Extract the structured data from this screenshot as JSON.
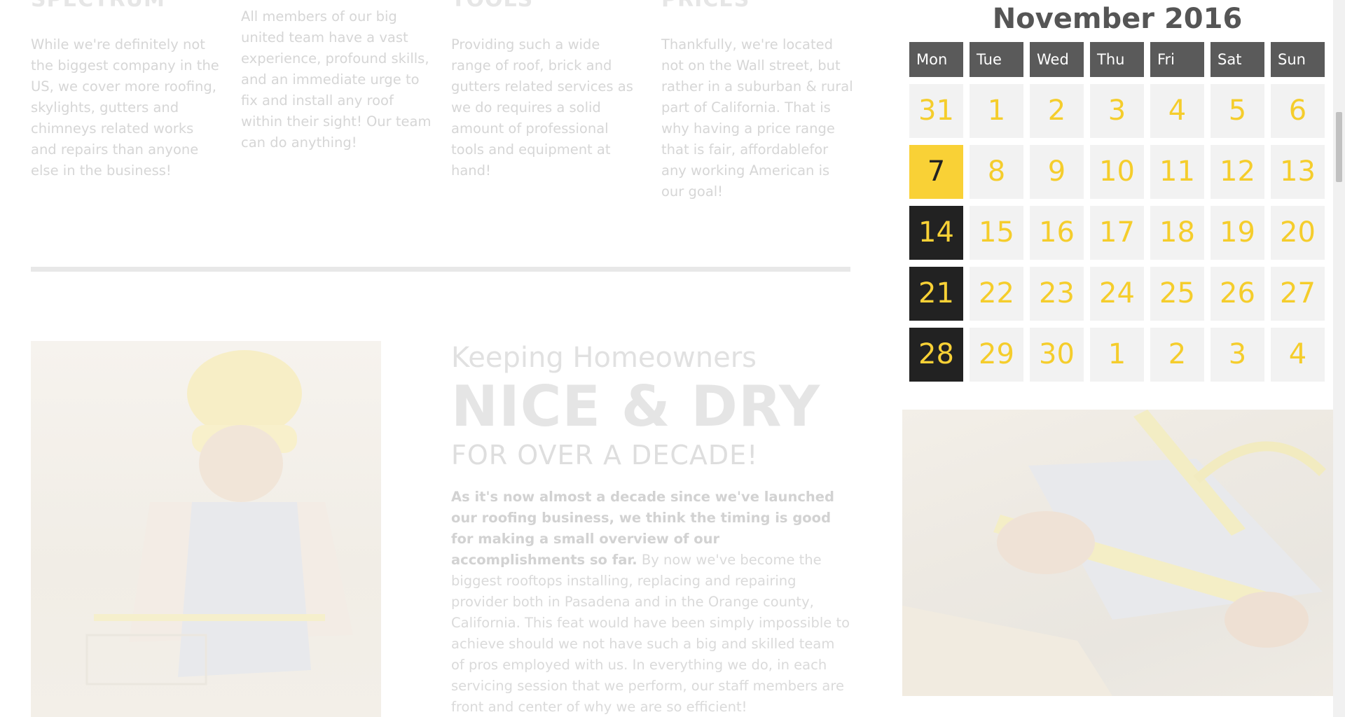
{
  "features": [
    {
      "heading": "SPECTRUM",
      "text": "While we're definitely not the biggest company in the US, we cover more roofing, skylights, gutters and chimneys related works and repairs than anyone else in the business!"
    },
    {
      "heading": "",
      "text": "All members of our big united team have a vast experience, profound skills, and an immediate urge to fix and install any roof within their sight! Our team can do anything!"
    },
    {
      "heading": "TOOLS",
      "text": "Providing such a wide range of roof, brick and gutters related services as we do requires a solid amount of professional tools and equipment at hand!"
    },
    {
      "heading": "PRICES",
      "text": "Thankfully, we're located not on the Wall street, but rather in a suburban & rural part of California. That is why having a price range that is fair, affordablefor any working American is our goal!"
    }
  ],
  "intro": {
    "small_heading": "Keeping Homeowners",
    "big_heading": "NICE & DRY",
    "sub_heading": "FOR OVER A DECADE!",
    "lead_text": "As it's now almost a decade since we've launched our roofing business, we think the timing is good for making a small overview of our accomplishments so far.",
    "body_text": " By now we've become the biggest rooftops installing, replacing and repairing provider both in Pasadena and in the Orange county, California. This feat would have been simply impossible to achieve should we not have such a big and skilled team of pros employed with us. In everything we do, in each servicing session that we perform, our staff members are front and center of why we are so efficient!"
  },
  "calendar": {
    "title": "November 2016",
    "weekdays": [
      "Mon",
      "Tue",
      "Wed",
      "Thu",
      "Fri",
      "Sat",
      "Sun"
    ],
    "weeks": [
      [
        "31",
        "1",
        "2",
        "3",
        "4",
        "5",
        "6"
      ],
      [
        "7",
        "8",
        "9",
        "10",
        "11",
        "12",
        "13"
      ],
      [
        "14",
        "15",
        "16",
        "17",
        "18",
        "19",
        "20"
      ],
      [
        "21",
        "22",
        "23",
        "24",
        "25",
        "26",
        "27"
      ],
      [
        "28",
        "29",
        "30",
        "1",
        "2",
        "3",
        "4"
      ]
    ],
    "today": "7",
    "highlight_color": "#f9d136",
    "dark_color": "#222222"
  },
  "images": {
    "worker_photo": "construction worker measuring",
    "measure_photo": "hands measuring with yellow ruler"
  }
}
